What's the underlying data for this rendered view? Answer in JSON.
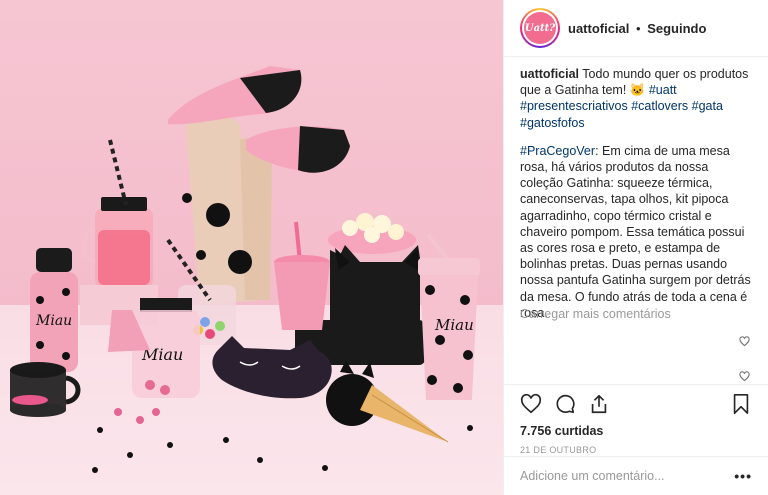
{
  "post": {
    "username": "uattoficial",
    "separator": "•",
    "follow_status": "Seguindo",
    "avatar_text": "Uatt?"
  },
  "caption": {
    "username": "uattoficial",
    "text": "Todo mundo quer os produtos que a Gatinha tem! 🐱",
    "tags": [
      "#uatt",
      "#presentescriativos",
      "#catlovers",
      "#gata",
      "#gatosfofos"
    ]
  },
  "description": {
    "tag": "#PraCegoVer",
    "text": ": Em cima de uma mesa rosa, há vários produtos da nossa coleção Gatinha: squeeze térmica, caneconservas, tapa olhos, kit pipoca agarradinho, copo térmico cristal e chaveiro pompom. Essa temática possui as cores rosa e preto, e estampa de bolinhas pretas. Duas pernas usando nossa pantufa Gatinha surgem por detrás da mesa. O fundo atrás de toda a cena é rosa."
  },
  "load_more": "Carregar mais comentários",
  "likes": "7.756 curtidas",
  "date": "21 DE OUTUBRO",
  "comment_input": {
    "placeholder": "Adicione um comentário..."
  },
  "more_label": "•••",
  "photo": {
    "product_text": "Miau"
  },
  "icons": [
    "heart-icon",
    "comment-icon",
    "share-icon",
    "bookmark-icon",
    "like-small-icon"
  ],
  "colors": {
    "tag": "#003569",
    "muted": "#999999",
    "pink_bg": "#f6c6d3"
  }
}
